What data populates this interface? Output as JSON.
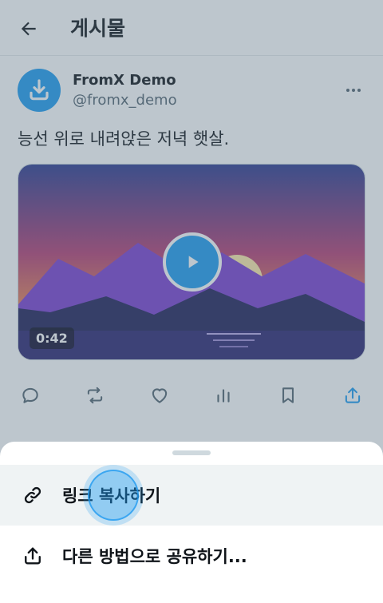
{
  "header": {
    "title": "게시물",
    "back_icon": "arrow-left-icon"
  },
  "post": {
    "author_name": "FromX Demo",
    "author_handle": "@fromx_demo",
    "avatar_icon": "download-icon",
    "more_icon": "more-horizontal-icon",
    "text": "능선 위로 내려앉은 저녁 햇살.",
    "video": {
      "duration": "0:42",
      "play_icon": "play-icon"
    }
  },
  "actions": [
    {
      "icon": "reply-icon"
    },
    {
      "icon": "repost-icon"
    },
    {
      "icon": "like-icon"
    },
    {
      "icon": "views-icon"
    },
    {
      "icon": "bookmark-icon"
    },
    {
      "icon": "share-icon",
      "color": "#1d9bf0"
    }
  ],
  "share_sheet": {
    "items": [
      {
        "label": "링크 복사하기",
        "icon": "link-icon"
      },
      {
        "label": "다른 방법으로 공유하기...",
        "icon": "share-icon"
      }
    ]
  },
  "colors": {
    "accent": "#1d9bf0",
    "text": "#0f1419",
    "secondary_text": "#536471"
  }
}
